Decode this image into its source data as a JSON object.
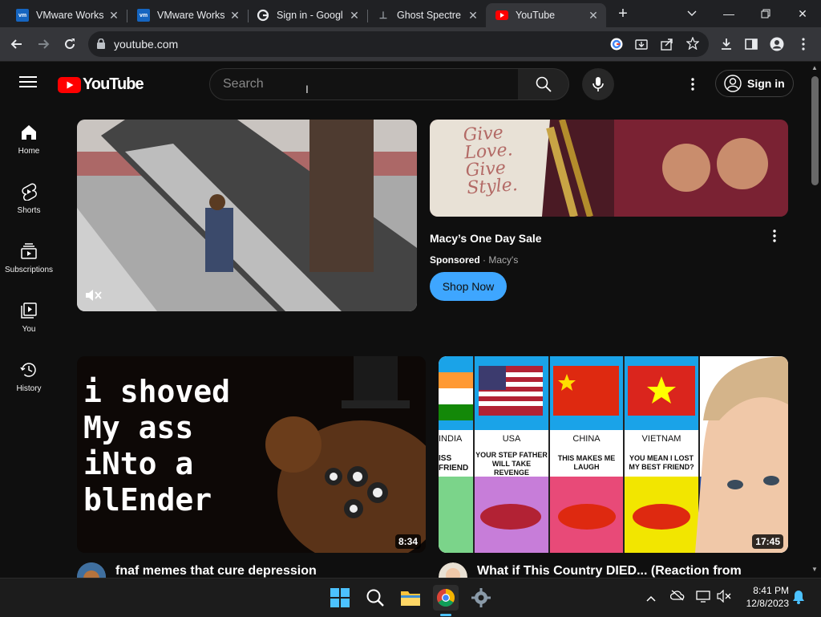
{
  "browser": {
    "tabs": [
      {
        "title": "VMware Works",
        "favicon": "vmware-icon"
      },
      {
        "title": "VMware Works",
        "favicon": "vmware-icon"
      },
      {
        "title": "Sign in - Googl",
        "favicon": "google-icon"
      },
      {
        "title": "Ghost Spectre",
        "favicon": "ghost-spectre-icon"
      },
      {
        "title": "YouTube",
        "favicon": "youtube-icon",
        "active": true
      }
    ],
    "url": "youtube.com"
  },
  "youtube": {
    "logo_text": "YouTube",
    "search_placeholder": "Search",
    "signin_label": "Sign in",
    "sidebar": [
      {
        "label": "Home",
        "icon": "home-icon"
      },
      {
        "label": "Shorts",
        "icon": "shorts-icon"
      },
      {
        "label": "Subscriptions",
        "icon": "subscriptions-icon"
      },
      {
        "label": "You",
        "icon": "you-icon"
      },
      {
        "label": "History",
        "icon": "history-icon"
      }
    ],
    "ad": {
      "title": "Macy’s One Day Sale",
      "sponsored": "Sponsored",
      "advertiser": "Macy's",
      "cta": "Shop Now",
      "image_text": "Give Love. Give Style."
    },
    "videos": [
      {
        "title": "fnaf memes that cure depression",
        "duration": "8:34",
        "thumb_text": "i shoved My ass iNto a blEnder"
      },
      {
        "title": "What if This Country DIED... (Reaction from",
        "duration": "17:45",
        "thumb_columns": [
          {
            "country": "INDIA",
            "caption": "ISS FRIEND"
          },
          {
            "country": "USA",
            "caption": "YOUR STEP FATHER WILL TAKE REVENGE"
          },
          {
            "country": "CHINA",
            "caption": "THIS MAKES ME LAUGH"
          },
          {
            "country": "VIETNAM",
            "caption": "YOU MEAN I LOST MY BEST FRIEND?"
          }
        ]
      }
    ]
  },
  "taskbar": {
    "time": "8:41 PM",
    "date": "12/8/2023"
  },
  "colors": {
    "youtube_red": "#ff0000",
    "shop_button": "#3ea6ff",
    "background": "#0f0f0f"
  }
}
